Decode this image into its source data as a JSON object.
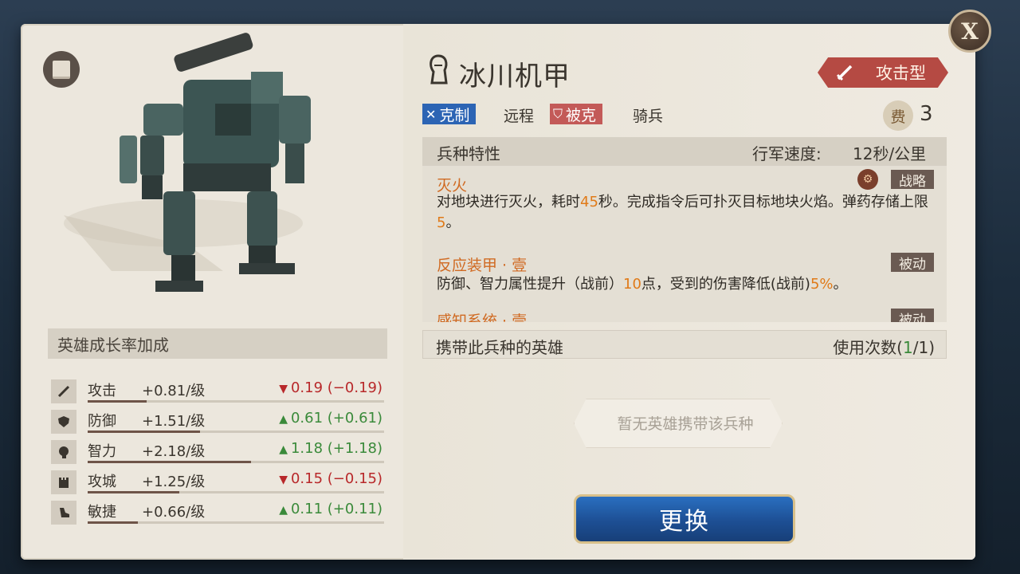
{
  "unit": {
    "name": "冰川机甲",
    "type_label": "攻击型",
    "counters_label": "克制",
    "counters_target": "远程",
    "countered_label": "被克",
    "countered_by": "骑兵",
    "cost_label": "费",
    "cost_value": "3"
  },
  "growth": {
    "header": "英雄成长率加成",
    "stats": [
      {
        "icon": "sword-icon",
        "name": "攻击",
        "rate": "+0.81/级",
        "change": "0.19 (−0.19)",
        "direction": "down",
        "level": 0.2
      },
      {
        "icon": "shield-icon",
        "name": "防御",
        "rate": "+1.51/级",
        "change": "0.61 (+0.61)",
        "direction": "up",
        "level": 0.38
      },
      {
        "icon": "head-icon",
        "name": "智力",
        "rate": "+2.18/级",
        "change": "1.18 (+1.18)",
        "direction": "up",
        "level": 0.55
      },
      {
        "icon": "tower-icon",
        "name": "攻城",
        "rate": "+1.25/级",
        "change": "0.15 (−0.15)",
        "direction": "down",
        "level": 0.31
      },
      {
        "icon": "boot-icon",
        "name": "敏捷",
        "rate": "+0.66/级",
        "change": "0.11 (+0.11)",
        "direction": "up",
        "level": 0.17
      }
    ]
  },
  "traits": {
    "header": "兵种特性",
    "march_label": "行军速度:",
    "march_value": "12秒/公里",
    "skills": [
      {
        "name": "灭火",
        "tag": "战略",
        "desc_a": "对地块进行灭火，耗时",
        "desc_hl1": "45",
        "desc_b": "秒。完成指令后可扑灭目标地块火焰。弹药存储上限",
        "desc_hl2": "5",
        "desc_c": "。"
      },
      {
        "name": "反应装甲 · 壹",
        "tag": "被动",
        "desc_a": "防御、智力属性提升（战前）",
        "desc_hl1": "10",
        "desc_b": "点，受到的伤害降低(战前)",
        "desc_hl2": "5%",
        "desc_c": "。"
      },
      {
        "name": "感知系统 · 壹",
        "tag": "被动"
      }
    ]
  },
  "heroes": {
    "header": "携带此兵种的英雄",
    "usage_label": "使用次数(",
    "usage_used": "1",
    "usage_total": "/1)",
    "empty_text": "暂无英雄携带该兵种"
  },
  "actions": {
    "swap_label": "更换",
    "close_label": "X"
  }
}
